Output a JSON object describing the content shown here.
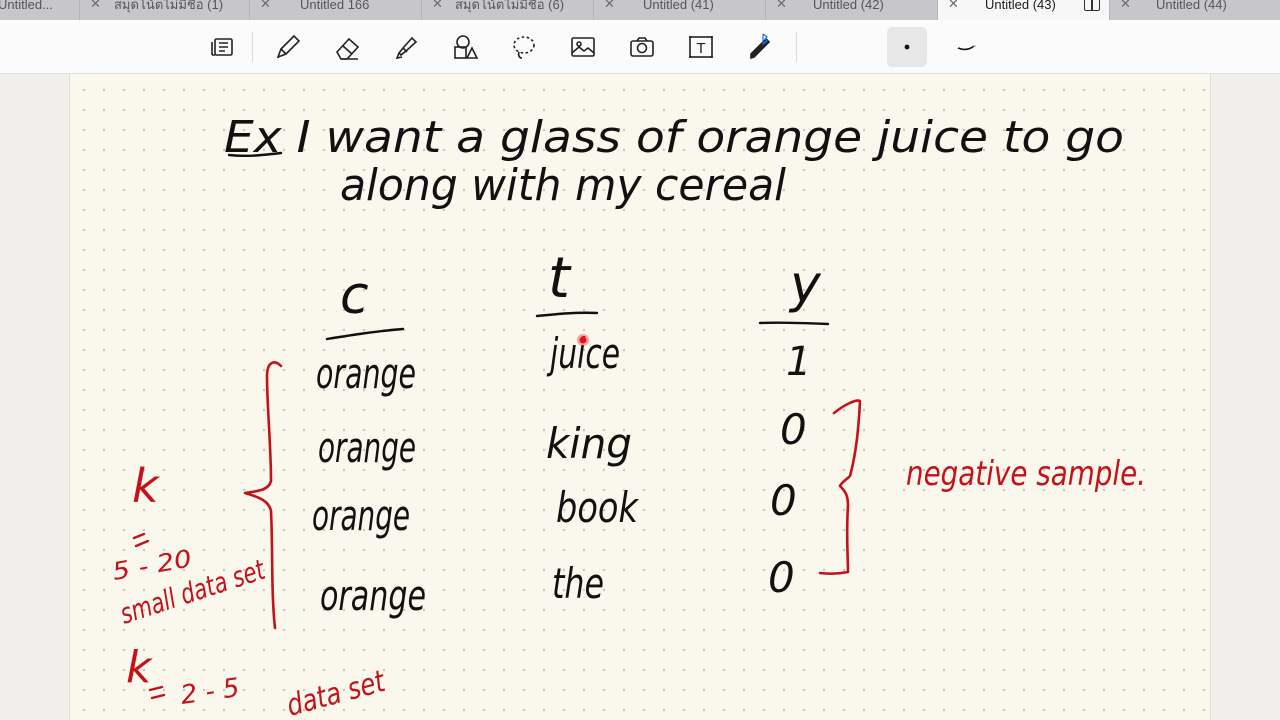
{
  "tabs": [
    {
      "label": "Untitled...",
      "closable": false,
      "active": false
    },
    {
      "label": "สมุดโน้ตไม่มีชื่อ (1)",
      "closable": true,
      "active": false
    },
    {
      "label": "Untitled 166",
      "closable": true,
      "active": false
    },
    {
      "label": "สมุดโน้ตไม่มีชื่อ (6)",
      "closable": true,
      "active": false
    },
    {
      "label": "Untitled (41)",
      "closable": true,
      "active": false
    },
    {
      "label": "Untitled (42)",
      "closable": true,
      "active": false
    },
    {
      "label": "Untitled (43)",
      "closable": true,
      "active": true
    },
    {
      "label": "Untitled (44)",
      "closable": true,
      "active": false
    }
  ],
  "toolbar": {
    "tools": [
      "page-layout-icon",
      "pen-icon",
      "eraser-icon",
      "highlighter-icon",
      "shapes-icon",
      "lasso-icon",
      "image-icon",
      "camera-icon",
      "text-icon",
      "bluetooth-laser-pointer-icon",
      "dot-pen-size-icon",
      "stroke-style-icon"
    ],
    "text_tool_glyph": "T"
  },
  "notes": {
    "sentence_line1": "Ex  I want a glass of orange juice to go",
    "sentence_line2": "along with my cereal",
    "col_c": "c",
    "col_t": "t",
    "col_y": "y",
    "rows": [
      {
        "c": "orange",
        "t": "juice",
        "y": "1"
      },
      {
        "c": "orange",
        "t": "king",
        "y": "0"
      },
      {
        "c": "orange",
        "t": "book",
        "y": "0"
      },
      {
        "c": "orange",
        "t": "the",
        "y": "0"
      }
    ],
    "negative_label": "negative sample.",
    "k_label": "k",
    "k_range_small": "5 - 20",
    "small_data_set": "small data set",
    "k_label_2": "k",
    "k_range_large": "2 - 5",
    "large_data_set": "data set"
  },
  "colors": {
    "ink_black": "#111111",
    "ink_red": "#c4121a",
    "paper": "#faf7ec",
    "active_tab": "#f7f7f7",
    "tabbar": "#c6c6cb"
  }
}
